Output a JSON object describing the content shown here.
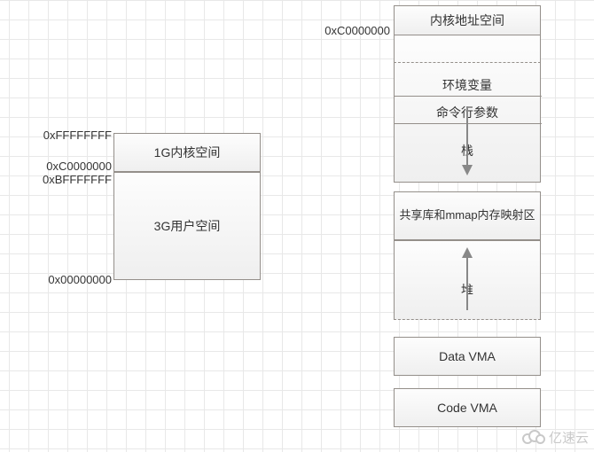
{
  "left_diagram": {
    "addresses": {
      "top": "0xFFFFFFFF",
      "mid1": "0xC0000000",
      "mid2": "0xBFFFFFFF",
      "bottom": "0x00000000"
    },
    "kernel_label": "1G内核空间",
    "user_label": "3G用户空间"
  },
  "right_diagram": {
    "address_top": "0xC0000000",
    "segments": {
      "kernel_space": "内核地址空间",
      "env_vars": "环境变量",
      "cmd_args": "命令行参数",
      "stack": "栈",
      "shared_mmap": "共享库和mmap内存映射区",
      "heap": "堆",
      "data_vma": "Data VMA",
      "code_vma": "Code VMA"
    }
  },
  "watermark": "亿速云",
  "chart_data": {
    "type": "table",
    "title": "Linux 32-bit process virtual address space layout",
    "left": {
      "rows": [
        {
          "range_start": "0xC0000000",
          "range_end": "0xFFFFFFFF",
          "label": "1G内核空间",
          "size_gb": 1
        },
        {
          "range_start": "0x00000000",
          "range_end": "0xBFFFFFFF",
          "label": "3G用户空间",
          "size_gb": 3
        }
      ]
    },
    "right": {
      "top_address": "0xC0000000",
      "segments_top_to_bottom": [
        "内核地址空间",
        "环境变量",
        "命令行参数",
        "栈",
        "共享库和mmap内存映射区",
        "堆",
        "Data VMA",
        "Code VMA"
      ],
      "grows_down": [
        "栈"
      ],
      "grows_up": [
        "堆"
      ]
    }
  }
}
